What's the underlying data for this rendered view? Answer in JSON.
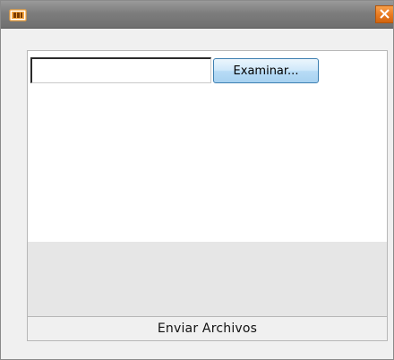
{
  "window": {
    "app_icon": "app-logo-icon",
    "close_icon": "close-icon",
    "accent_close": "#e8791f",
    "titlebar_color": "#7d7d7d"
  },
  "upload": {
    "file_input_value": "",
    "browse_label": "Examinar..."
  },
  "footer": {
    "submit_label": "Enviar Archivos"
  }
}
